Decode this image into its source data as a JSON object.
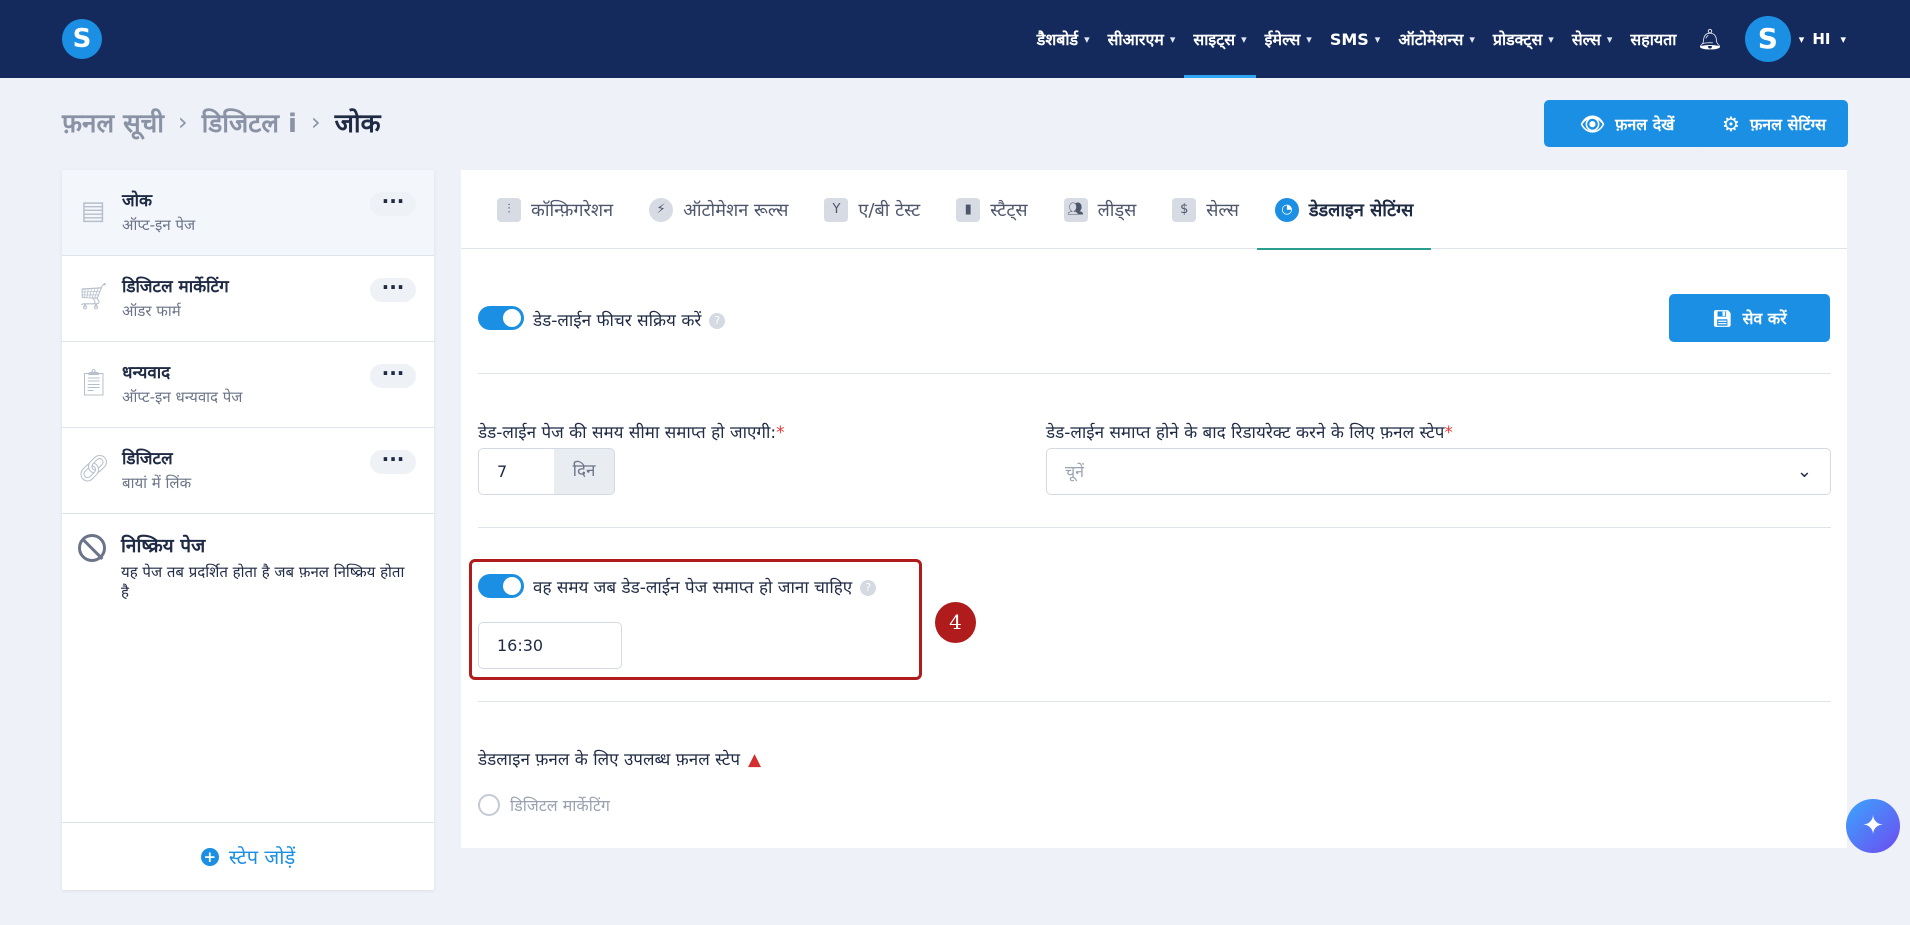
{
  "app": {
    "logo_letter": "S",
    "nav": [
      {
        "label": "डैशबोर्ड",
        "has_menu": true,
        "active": false
      },
      {
        "label": "सीआरएम",
        "has_menu": true,
        "active": false
      },
      {
        "label": "साइट्स",
        "has_menu": true,
        "active": true
      },
      {
        "label": "ईमेल्स",
        "has_menu": true,
        "active": false
      },
      {
        "label": "SMS",
        "has_menu": true,
        "active": false
      },
      {
        "label": "ऑटोमेशन्स",
        "has_menu": true,
        "active": false
      },
      {
        "label": "प्रोडक्ट्स",
        "has_menu": true,
        "active": false
      },
      {
        "label": "सेल्स",
        "has_menu": true,
        "active": false
      },
      {
        "label": "सहायता",
        "has_menu": false,
        "active": false
      }
    ],
    "avatar_letter": "S",
    "language": "HI",
    "accent_color": "#1a8fe3",
    "nav_bg_color": "#152a5c"
  },
  "breadcrumb": [
    "फ़नल सूची",
    "डिजिटल i",
    "जोक"
  ],
  "header_buttons": {
    "view_funnel": "फ़नल देखें",
    "funnel_settings": "फ़नल सेटिंग्स"
  },
  "sidebar": {
    "steps": [
      {
        "title": "जोक",
        "subtitle": "ऑप्ट-इन पेज",
        "icon": "optin-page-icon",
        "selected": true
      },
      {
        "title": "डिजिटल मार्केटिंग",
        "subtitle": "ऑडर फार्म",
        "icon": "cart-icon",
        "selected": false
      },
      {
        "title": "धन्यवाद",
        "subtitle": "ऑप्ट-इन धन्यवाद पेज",
        "icon": "clipboard-check-icon",
        "selected": false
      },
      {
        "title": "डिजिटल",
        "subtitle": "बायां में लिंक",
        "icon": "link-icon",
        "selected": false
      }
    ],
    "inactive_page": {
      "title": "निष्क्रिय पेज",
      "description": "यह पेज तब प्रदर्शित होता है जब फ़नल निष्क्रिय होता है"
    },
    "add_step_label": "स्टेप जोड़ें"
  },
  "tabs": [
    {
      "label": "कॉन्फ़िगरेशन",
      "icon": "sliders-icon",
      "active": false
    },
    {
      "label": "ऑटोमेशन रूल्स",
      "icon": "bolt-icon",
      "active": false
    },
    {
      "label": "ए/बी टेस्ट",
      "icon": "split-icon",
      "active": false
    },
    {
      "label": "स्टैट्स",
      "icon": "bar-chart-icon",
      "active": false
    },
    {
      "label": "लीड्स",
      "icon": "users-icon",
      "active": false
    },
    {
      "label": "सेल्स",
      "icon": "dollar-icon",
      "active": false
    },
    {
      "label": "डेडलाइन सेटिंग्स",
      "icon": "clock-icon",
      "active": true
    }
  ],
  "deadline": {
    "enable_label": "डेड-लाईन फीचर सक्रिय करें",
    "enable_on": true,
    "save_label": "सेव करें",
    "expire_label": "डेड-लाईन पेज की समय सीमा समाप्त हो जाएगी:",
    "expire_value": "7",
    "expire_unit": "दिन",
    "redirect_label": "डेड-लाईन समाप्त होने के बाद रिडायरेक्ट करने के लिए फ़नल स्टेप",
    "redirect_placeholder": "चूनें",
    "time_toggle_label": "वह समय जब डेड-लाईन पेज समाप्त हो जाना चाहिए",
    "time_toggle_on": true,
    "time_value": "16:30",
    "steps_label": "डेडलाइन फ़नल के लिए उपलब्ध फ़नल स्टेप",
    "available_steps": [
      "डिजिटल मार्केटिंग"
    ]
  },
  "annotation": {
    "number": "4"
  }
}
